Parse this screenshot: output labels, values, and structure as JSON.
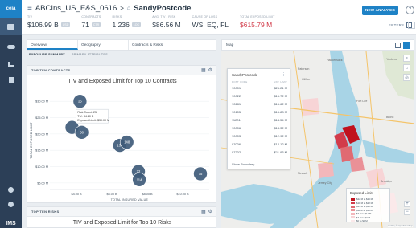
{
  "app": {
    "logo": "ceia",
    "brand": "IMS"
  },
  "breadcrumb": {
    "account": "ABCIns_US_E&S_0616",
    "separator": ">",
    "analysis": "SandyPostcode"
  },
  "stats": [
    {
      "label": "TIV",
      "value": "$106.99 B",
      "chip": "USD"
    },
    {
      "label": "CONTRACTS",
      "value": "71",
      "chip": "CTR"
    },
    {
      "label": "RISKS",
      "value": "1,236",
      "chip": "LOC"
    },
    {
      "label": "AVG. TIV / RISK",
      "value": "$86.56 M"
    },
    {
      "label": "CAUSE OF LOSS",
      "value": "WS, EQ, FL"
    },
    {
      "label": "TOTAL EXPOSED LIMIT",
      "value": "$615.79 M"
    }
  ],
  "toolbar": {
    "new_analysis": "NEW ANALYSIS",
    "help": "?",
    "filters": "FILTERS",
    "more": "⋮"
  },
  "left_tabs": [
    "Overview",
    "Geography",
    "Contracts & Risks"
  ],
  "sub_tabs": [
    "EXPOSURE SUMMARY",
    "PRIMARY ATTRIBUTES"
  ],
  "card1": {
    "header": "TOP TEN CONTRACTS",
    "title": "TIV and Exposed Limit for Top 10 Contracts"
  },
  "card2": {
    "header": "TOP TEN RISKS",
    "title": "TIV and Exposed Limit for Top 10 Risks"
  },
  "tooltip": {
    "line1": "Risk Count: 25",
    "line2": "TIV: $4.20 B",
    "line3": "Exposed Limit: $30.00 M"
  },
  "chart_data": {
    "type": "scatter",
    "title": "TIV and Exposed Limit for Top 10 Contracts",
    "xlabel": "TOTAL INSURED VALUE",
    "ylabel": "TOTAL EXPOSED LIMIT",
    "xticks": [
      "$4.00 B",
      "$6.00 B",
      "$8.00 B",
      "$10.00 B"
    ],
    "yticks": [
      "$5.00 M",
      "$10.00 M",
      "$15.00 M",
      "$20.00 M",
      "$25.00 M",
      "$30.00 M"
    ],
    "xlim": [
      2.5,
      11.5
    ],
    "ylim": [
      3,
      33
    ],
    "points": [
      {
        "x": 4.2,
        "y": 30.0,
        "label": "25"
      },
      {
        "x": 3.75,
        "y": 22.0,
        "label": ""
      },
      {
        "x": 4.3,
        "y": 20.5,
        "label": "30"
      },
      {
        "x": 6.45,
        "y": 16.5,
        "label": "137"
      },
      {
        "x": 6.85,
        "y": 17.5,
        "label": "148"
      },
      {
        "x": 7.5,
        "y": 8.5,
        "label": "22"
      },
      {
        "x": 7.55,
        "y": 6.0,
        "label": "114"
      },
      {
        "x": 11.0,
        "y": 7.8,
        "label": "75"
      }
    ]
  },
  "map": {
    "tab": "Map",
    "popup": {
      "title": "SandyPostcode",
      "menu": "⋮",
      "col1": "POST CODE",
      "col2": "EXP. LIMIT",
      "rows": [
        {
          "code": "10001",
          "limit": "$26.21 M"
        },
        {
          "code": "10022",
          "limit": "$16.72 M"
        },
        {
          "code": "10281",
          "limit": "$16.62 M"
        },
        {
          "code": "10105",
          "limit": "$15.88 M"
        },
        {
          "code": "11201",
          "limit": "$14.54 M"
        },
        {
          "code": "10006",
          "limit": "$13.32 M"
        },
        {
          "code": "10003",
          "limit": "$12.92 M"
        },
        {
          "code": "07006",
          "limit": "$12.12 M"
        },
        {
          "code": "07302",
          "limit": "$11.93 M"
        }
      ],
      "show_boundary": "Show Boundary"
    },
    "legend": {
      "title": "Exposed Limit",
      "items": [
        {
          "label": "$22 M to $26 M",
          "color": "#c0121e"
        },
        {
          "label": "$18 M to $22 M",
          "color": "#d23b4a"
        },
        {
          "label": "$14 M to $18 M",
          "color": "#e06a72"
        },
        {
          "label": "$11 M to $14 M",
          "color": "#ea9197"
        },
        {
          "label": "$7 M to $11 M",
          "color": "#f2b7bb"
        },
        {
          "label": "$4 M to $7 M",
          "color": "#f7d4d6"
        },
        {
          "label": "$0 to $4 M",
          "color": "#fbe9ea"
        }
      ]
    },
    "places": [
      "Hackensack",
      "Clifton",
      "Paterson",
      "Fort Lee",
      "Yonkers",
      "Bronx",
      "Newark",
      "Jersey City",
      "Brooklyn"
    ],
    "attribution": "Leaflet | © OpenStreetMap"
  },
  "colors": {
    "accent": "#1e82c6",
    "bubble": "#3f5b7a",
    "rail": "#2c3f57"
  }
}
